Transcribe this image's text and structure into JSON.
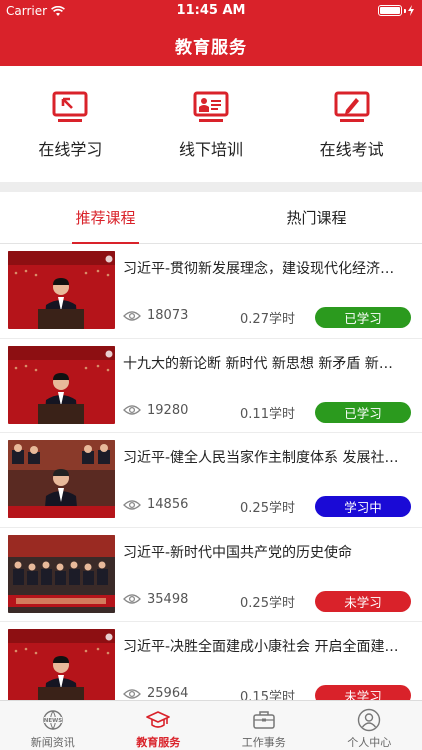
{
  "status_bar": {
    "carrier": "Carrier",
    "time": "11:45 AM"
  },
  "nav": {
    "title": "教育服务"
  },
  "services": [
    {
      "label": "在线学习",
      "icon": "online-study-icon"
    },
    {
      "label": "线下培训",
      "icon": "offline-training-icon"
    },
    {
      "label": "在线考试",
      "icon": "online-exam-icon"
    }
  ],
  "tabs": [
    {
      "label": "推荐课程",
      "active": true
    },
    {
      "label": "热门课程",
      "active": false
    }
  ],
  "courses": [
    {
      "title": "习近平-贯彻新发展理念，建设现代化经济体系",
      "views": "18073",
      "hours": "0.27学时",
      "status": "已学习",
      "status_color": "#2b9a1e"
    },
    {
      "title": "十九大的新论断 新时代 新思想 新矛盾 新目标",
      "views": "19280",
      "hours": "0.11学时",
      "status": "已学习",
      "status_color": "#2b9a1e"
    },
    {
      "title": "习近平-健全人民当家作主制度体系 发展社会主义民主政治",
      "views": "14856",
      "hours": "0.25学时",
      "status": "学习中",
      "status_color": "#1a0ad6"
    },
    {
      "title": "习近平-新时代中国共产党的历史使命",
      "views": "35498",
      "hours": "0.25学时",
      "status": "未学习",
      "status_color": "#d9222a"
    },
    {
      "title": "习近平-决胜全面建成小康社会 开启全面建设社会主义现代化国家新征程",
      "views": "25964",
      "hours": "0.15学时",
      "status": "未学习",
      "status_color": "#d9222a"
    }
  ],
  "tabbar": [
    {
      "label": "新闻资讯",
      "icon": "news-icon",
      "active": false
    },
    {
      "label": "教育服务",
      "icon": "graduation-cap-icon",
      "active": true
    },
    {
      "label": "工作事务",
      "icon": "briefcase-icon",
      "active": false
    },
    {
      "label": "个人中心",
      "icon": "user-icon",
      "active": false
    }
  ],
  "colors": {
    "brand": "#d9222a",
    "done": "#2b9a1e",
    "in_progress": "#1a0ad6",
    "not_started": "#d9222a"
  }
}
